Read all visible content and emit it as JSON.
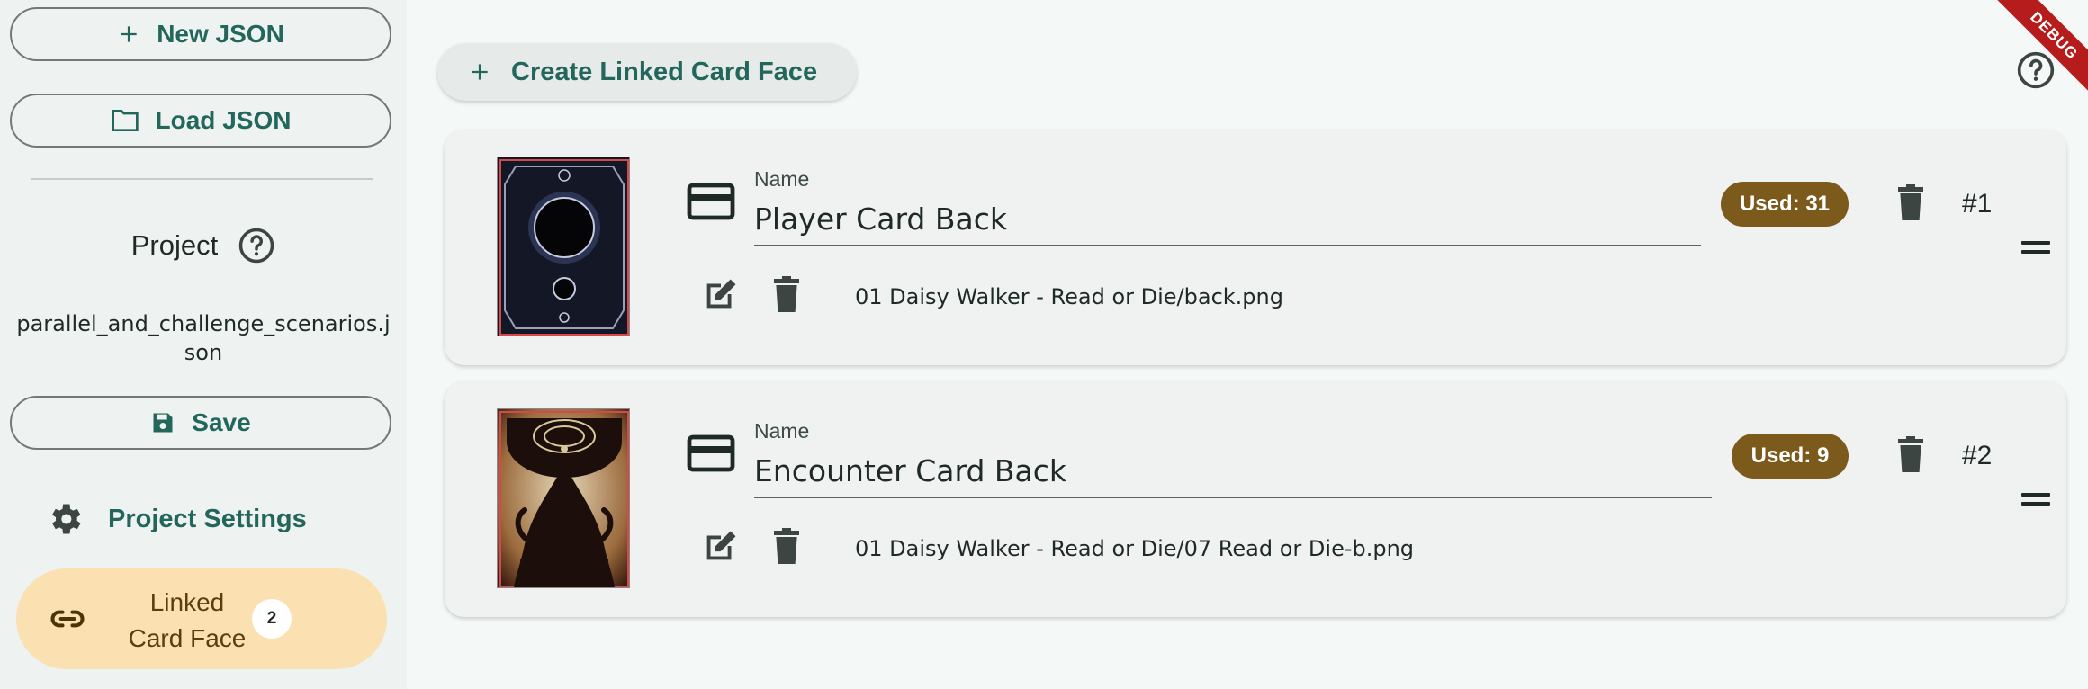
{
  "sidebar": {
    "new_json_label": "New JSON",
    "load_json_label": "Load JSON",
    "project_title": "Project",
    "file_name_line1": "parallel_and_challenge_scenarios.j",
    "file_name_line2": "son",
    "save_label": "Save",
    "settings_label": "Project Settings",
    "linked_line1": "Linked",
    "linked_line2": "Card Face",
    "linked_count": "2"
  },
  "main": {
    "create_label": "Create Linked Card Face",
    "debug_label": "DEBUG",
    "name_field_label": "Name",
    "cards": [
      {
        "name": "Player Card Back",
        "path": "01 Daisy Walker - Read or Die/back.png",
        "used": "Used: 31",
        "index": "#1"
      },
      {
        "name": "Encounter Card Back",
        "path": "01 Daisy Walker - Read or Die/07 Read or Die-b.png",
        "used": "Used: 9",
        "index": "#2"
      }
    ]
  },
  "colors": {
    "accent": "#22665c",
    "badge": "#7b5a1b",
    "selected_nav": "#fbe0b2"
  }
}
